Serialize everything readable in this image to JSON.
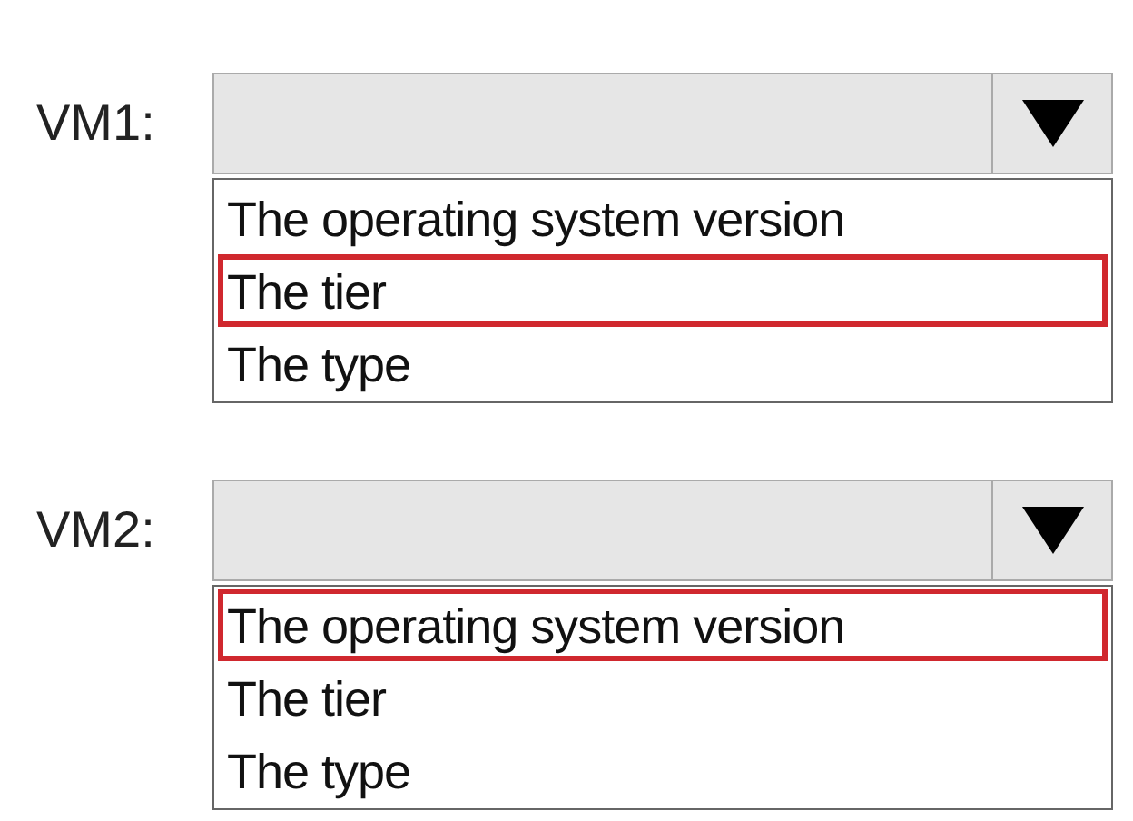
{
  "dropdowns": [
    {
      "label": "VM1:",
      "options": [
        {
          "text": "The operating system version",
          "selected": false
        },
        {
          "text": "The tier",
          "selected": true
        },
        {
          "text": "The type",
          "selected": false
        }
      ]
    },
    {
      "label": "VM2:",
      "options": [
        {
          "text": "The operating system version",
          "selected": true
        },
        {
          "text": "The tier",
          "selected": false
        },
        {
          "text": "The type",
          "selected": false
        }
      ]
    }
  ]
}
